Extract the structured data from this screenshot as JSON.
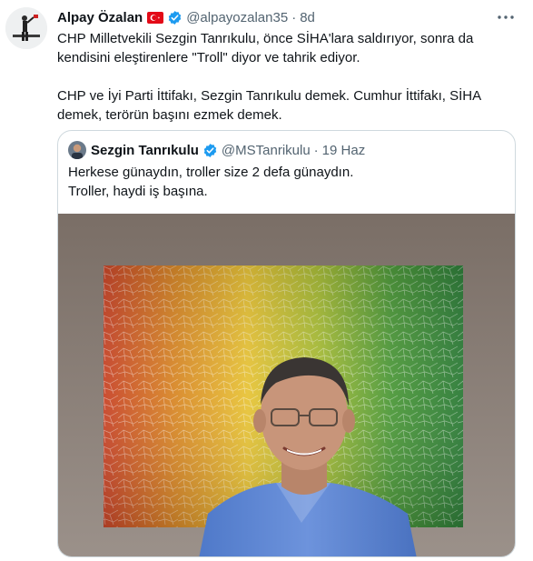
{
  "tweet": {
    "author_name": "Alpay Özalan",
    "author_handle": "@alpayozalan35",
    "separator": "·",
    "time": "8d",
    "text_lines": [
      "CHP Milletvekili Sezgin Tanrıkulu, önce SİHA'lara saldırıyor, sonra da kendisini eleştirenlere \"Troll\" diyor ve tahrik ediyor.",
      "CHP ve İyi Parti İttifakı, Sezgin Tanrıkulu demek. Cumhur İttifakı, SİHA demek, terörün başını ezmek demek."
    ]
  },
  "quoted": {
    "author_name": "Sezgin Tanrıkulu",
    "author_handle": "@MSTanrikulu",
    "separator": "·",
    "time": "19 Haz",
    "text_lines": [
      "Herkese günaydın, troller size 2 defa günaydın.",
      "Troller, haydi iş başına."
    ]
  },
  "icons": {
    "flag": "turkey-flag-icon",
    "verified": "verified-badge-icon",
    "more": "more-options-icon"
  },
  "colors": {
    "verified_blue": "#1d9bf0",
    "secondary_text": "#536471",
    "border": "#cfd9de",
    "flag_red": "#e30a17"
  }
}
